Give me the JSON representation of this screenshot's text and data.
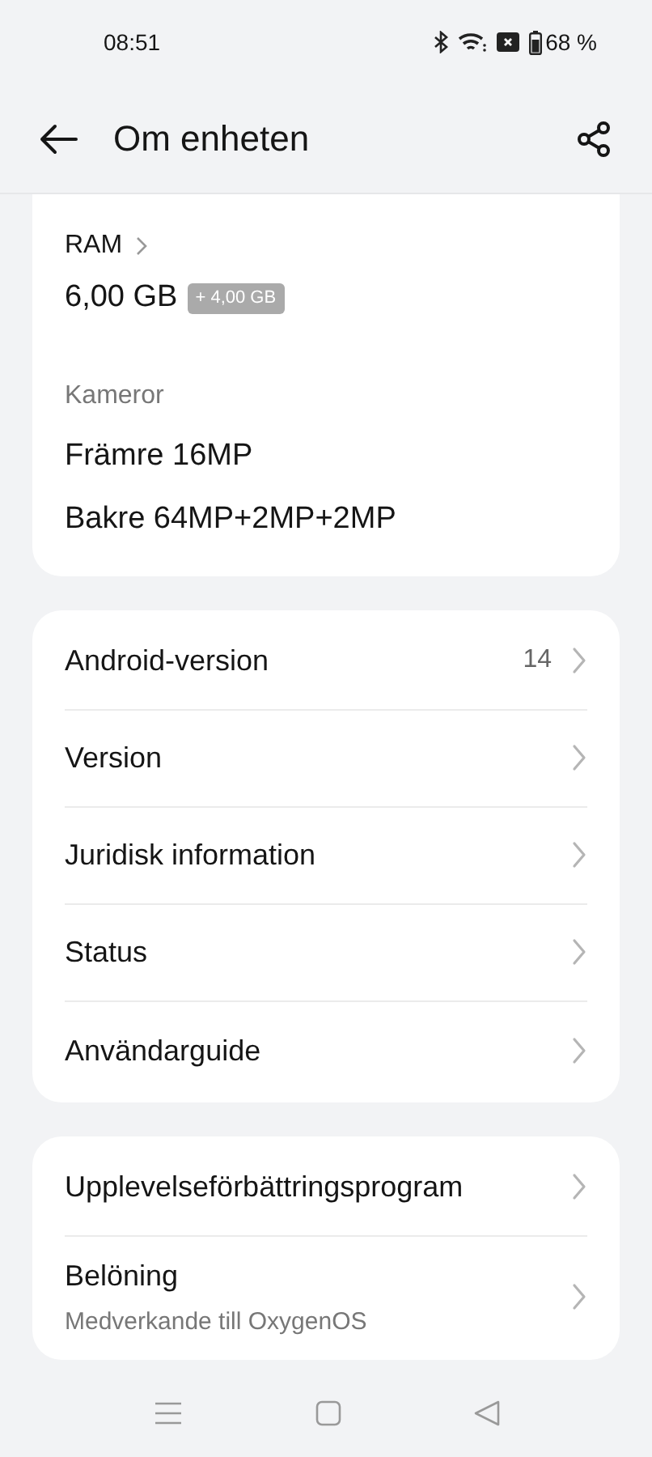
{
  "status_bar": {
    "time": "08:51",
    "battery": "68 %"
  },
  "header": {
    "title": "Om enheten"
  },
  "specs": {
    "ram_label": "RAM",
    "ram_value": "6,00 GB",
    "ram_extra": "+ 4,00 GB",
    "camera_label": "Kameror",
    "cameras": [
      "Främre 16MP",
      "Bakre 64MP+2MP+2MP"
    ]
  },
  "settings_groups": [
    {
      "items": [
        {
          "label": "Android-version",
          "value": "14"
        },
        {
          "label": "Version"
        },
        {
          "label": "Juridisk information"
        },
        {
          "label": "Status"
        },
        {
          "label": "Användarguide"
        }
      ]
    },
    {
      "items": [
        {
          "label": "Upplevelseförbättringsprogram"
        },
        {
          "label": "Belöning",
          "subtitle": "Medverkande till OxygenOS"
        }
      ]
    }
  ]
}
